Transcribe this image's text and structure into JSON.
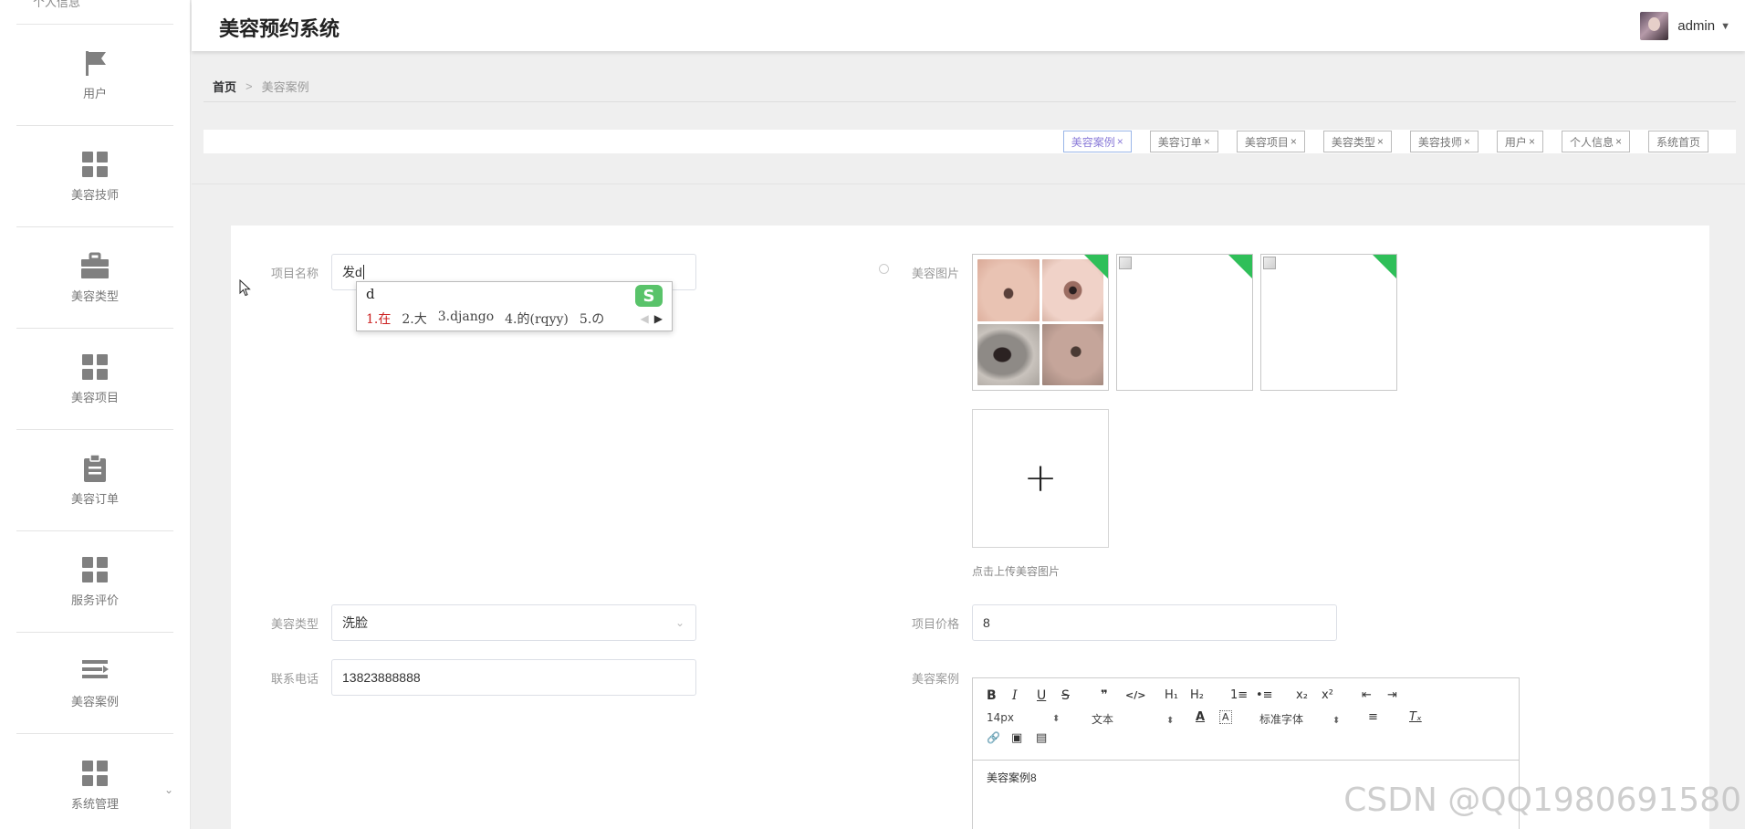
{
  "app": {
    "title": "美容预约系统"
  },
  "user": {
    "name": "admin"
  },
  "sidebar": {
    "top_label": "个人信息",
    "items": [
      {
        "label": "用户",
        "icon": "flag-icon"
      },
      {
        "label": "美容技师",
        "icon": "grid-icon"
      },
      {
        "label": "美容类型",
        "icon": "briefcase-icon"
      },
      {
        "label": "美容项目",
        "icon": "grid-icon"
      },
      {
        "label": "美容订单",
        "icon": "clipboard-icon"
      },
      {
        "label": "服务评价",
        "icon": "grid-icon"
      },
      {
        "label": "美容案例",
        "icon": "list-icon"
      },
      {
        "label": "系统管理",
        "icon": "grid-icon"
      }
    ]
  },
  "breadcrumb": {
    "home": "首页",
    "separator": ">",
    "current": "美容案例"
  },
  "tags": [
    {
      "label": "美容案例",
      "close": "×"
    },
    {
      "label": "美容订单",
      "close": "×"
    },
    {
      "label": "美容项目",
      "close": "×"
    },
    {
      "label": "美容类型",
      "close": "×"
    },
    {
      "label": "美容技师",
      "close": "×"
    },
    {
      "label": "用户",
      "close": "×"
    },
    {
      "label": "个人信息",
      "close": "×"
    },
    {
      "label": "系统首页",
      "close": ""
    }
  ],
  "form": {
    "project_name": {
      "label": "项目名称",
      "value": "发d"
    },
    "beauty_images": {
      "label": "美容图片",
      "hint": "点击上传美容图片"
    },
    "beauty_type": {
      "label": "美容类型",
      "value": "洗脸"
    },
    "project_price": {
      "label": "项目价格",
      "value": "8"
    },
    "phone": {
      "label": "联系电话",
      "value": "13823888888"
    },
    "case": {
      "label": "美容案例",
      "content": "美容案例8"
    }
  },
  "ime": {
    "composition": "d",
    "candidates": [
      "1.在",
      "2.大",
      "3.django",
      "4.的(rqyy)",
      "5.の"
    ],
    "logo": "S"
  },
  "editor": {
    "font_size": "14px",
    "block_type": "文本",
    "font_family": "标准字体",
    "buttons": {
      "bold": "B",
      "italic": "I",
      "underline": "U",
      "strike": "S",
      "quote": "❞",
      "code": "</>",
      "h1": "H₁",
      "h2": "H₂",
      "ordered_list": "1≡",
      "bullet_list": "•≡",
      "sub": "x₂",
      "sup": "x²",
      "outdent": "⇤",
      "indent": "⇥",
      "color": "A",
      "background": "A",
      "align": "≡",
      "clean": "Tₓ",
      "link": "🔗",
      "image": "▣",
      "video": "▤"
    }
  },
  "watermark": "CSDN @QQ1980691580",
  "colors": {
    "accent": "#2fbf59",
    "active_tag": "#8a7bd8",
    "icon_gray": "#808080"
  }
}
